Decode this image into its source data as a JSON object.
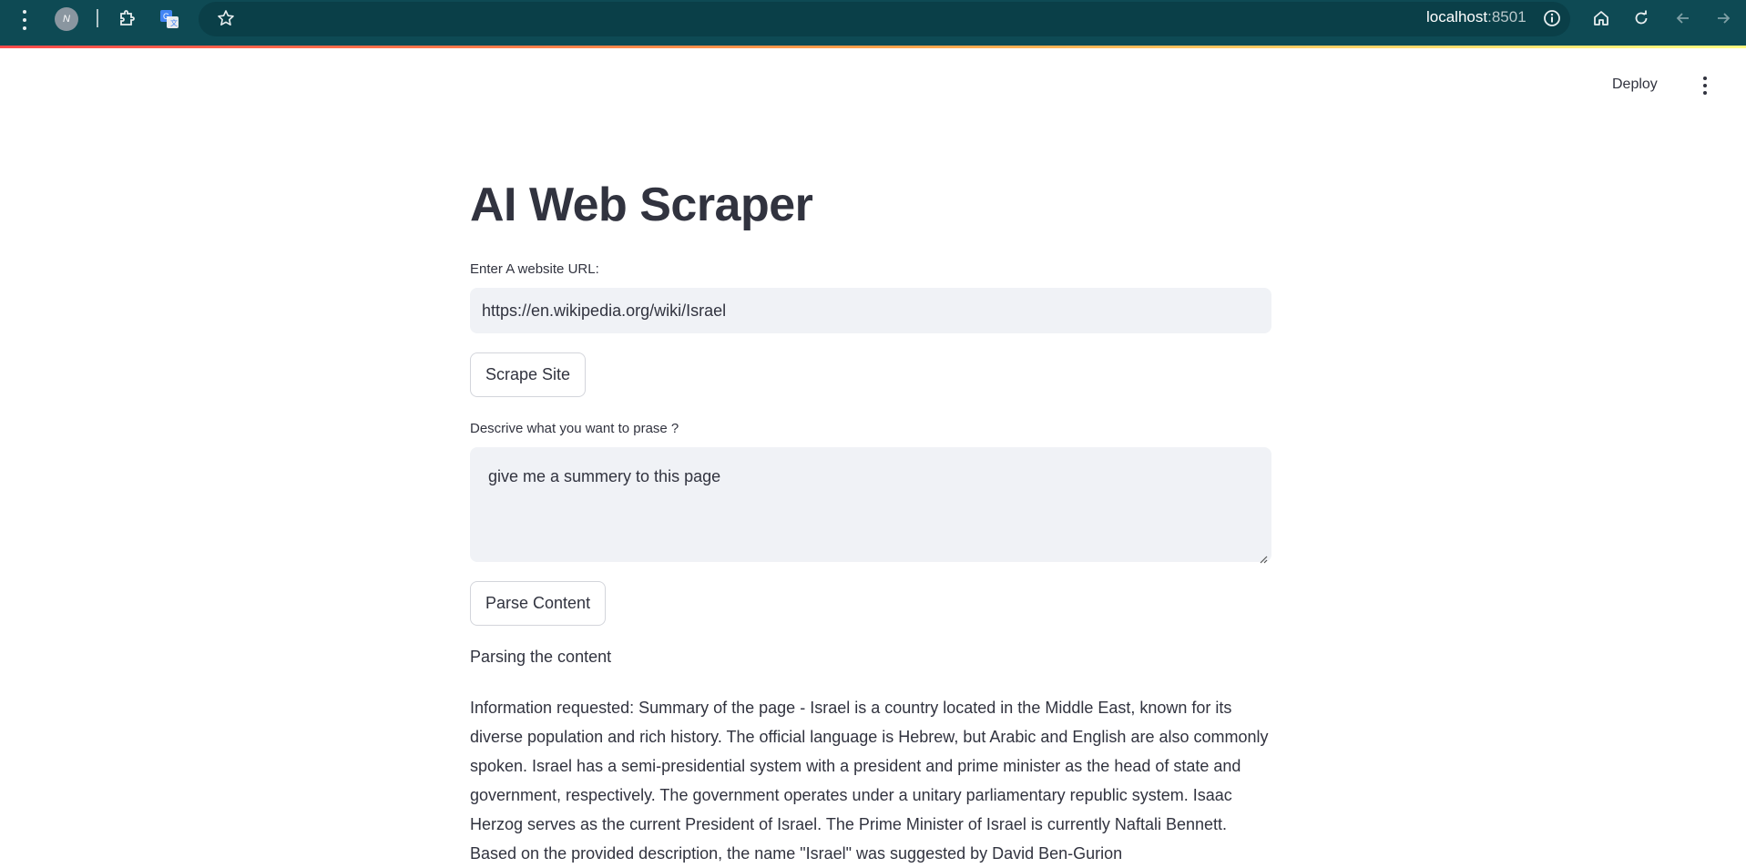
{
  "browser": {
    "host": "localhost",
    "port": ":8501",
    "profile_initial": "N",
    "icons": [
      "more-vert-icon",
      "profile-avatar",
      "extensions-icon",
      "translate-icon",
      "star-icon",
      "info-icon",
      "home-icon",
      "reload-icon",
      "back-icon",
      "forward-icon"
    ]
  },
  "header": {
    "deploy_label": "Deploy"
  },
  "main": {
    "title": "AI Web Scraper",
    "url_label": "Enter A website URL:",
    "url_value": "https://en.wikipedia.org/wiki/Israel",
    "scrape_button": "Scrape Site",
    "describe_label": "Descrive what you want to prase ?",
    "describe_value": "give me a summery to this page",
    "parse_button": "Parse Content",
    "status": "Parsing the content",
    "result": "Information requested: Summary of the page - Israel is a country located in the Middle East, known for its diverse population and rich history. The official language is Hebrew, but Arabic and English are also commonly spoken. Israel has a semi-presidential system with a president and prime minister as the head of state and government, respectively. The government operates under a unitary parliamentary republic system. Isaac Herzog serves as the current President of Israel. The Prime Minister of Israel is currently Naftali Bennett. Based on the provided description, the name \"Israel\" was suggested by David Ben-Gurion"
  },
  "colors": {
    "browser_bar": "#0e4a54",
    "text": "#31333f",
    "input_bg": "#f0f2f6",
    "accent_gradient_start": "#ff4b4b"
  }
}
